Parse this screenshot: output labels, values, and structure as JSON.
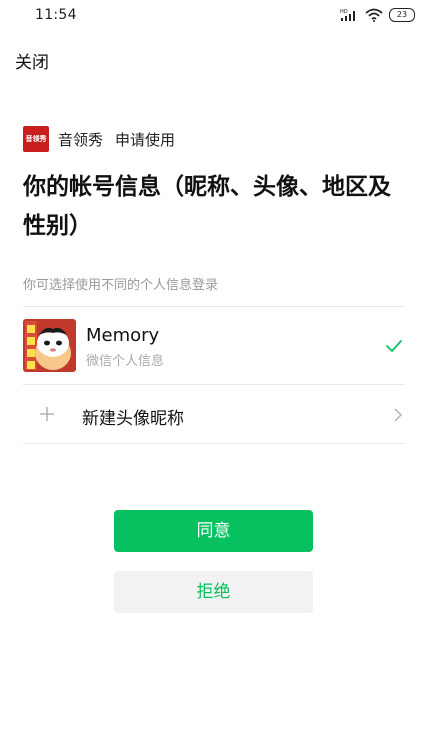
{
  "status_bar": {
    "time": "11:54",
    "network_label": "HD",
    "battery": "23"
  },
  "header": {
    "close_label": "关闭"
  },
  "app": {
    "name": "音领秀",
    "request_text": "申请使用",
    "logo_text": "音领秀",
    "brand_color": "#c81e1e"
  },
  "title": "你的帐号信息（昵称、头像、地区及性别）",
  "hint": "你可选择使用不同的个人信息登录",
  "accounts": [
    {
      "name": "Memory",
      "subtitle": "微信个人信息",
      "selected": true,
      "avatar_icon": "cartoon-avatar"
    }
  ],
  "new_profile": {
    "label": "新建头像昵称"
  },
  "actions": {
    "agree_label": "同意",
    "refuse_label": "拒绝"
  },
  "colors": {
    "accent": "#07c160",
    "muted_text": "#999999",
    "secondary_button_bg": "#f2f2f2"
  }
}
